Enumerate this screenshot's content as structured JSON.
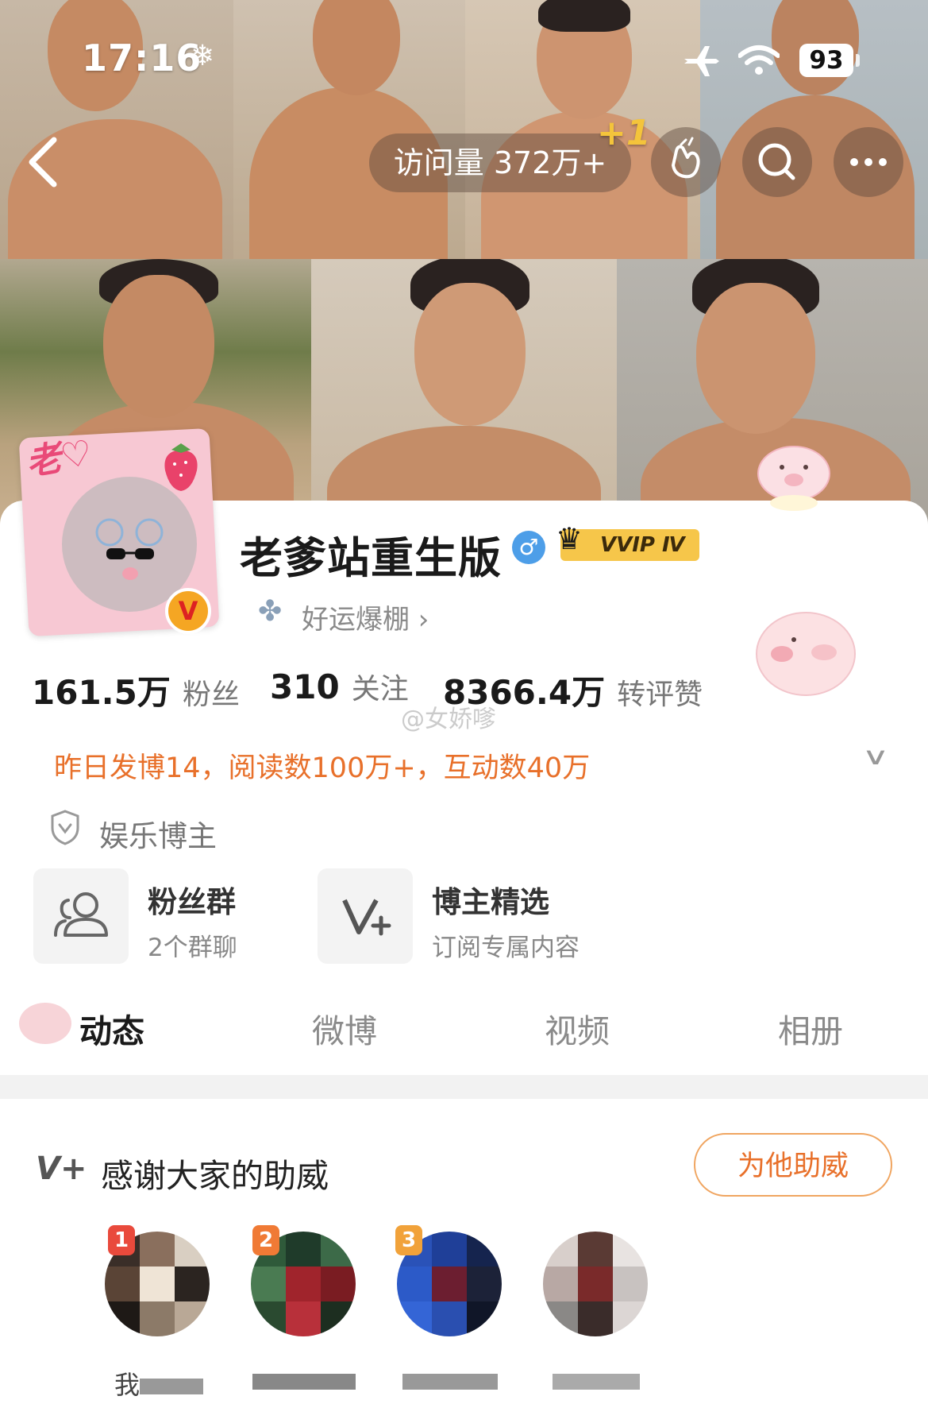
{
  "status_bar": {
    "time": "17:16",
    "battery": "93"
  },
  "nav": {
    "visit_label": "访问量 372万+",
    "visit_plus": "+1"
  },
  "profile": {
    "name": "老爹站重生版",
    "gender_symbol": "♂",
    "vvip_label": "VVIP Ⅳ",
    "luck_label": "好运爆棚 ›",
    "stats": [
      {
        "value": "161.5万",
        "label": "粉丝"
      },
      {
        "value": "310",
        "label": "关注"
      },
      {
        "value": "8366.4万",
        "label": "转评赞"
      }
    ],
    "watermark": "@女娇嗲",
    "activity": "昨日发博14，阅读数100万+，互动数40万",
    "blogger_type": "娱乐博主"
  },
  "features": [
    {
      "title": "粉丝群",
      "sub": "2个群聊"
    },
    {
      "title": "博主精选",
      "sub": "订阅专属内容"
    }
  ],
  "tabs": [
    "动态",
    "微博",
    "视频",
    "相册"
  ],
  "support": {
    "title": "感谢大家的助威",
    "button": "为他助威",
    "ranks": [
      "1",
      "2",
      "3"
    ],
    "names": [
      "我",
      "",
      "",
      ""
    ]
  },
  "colors": {
    "accent_orange": "#e8702a",
    "vvip_gold": "#f6c64a",
    "gender_blue": "#4d9ee8"
  }
}
